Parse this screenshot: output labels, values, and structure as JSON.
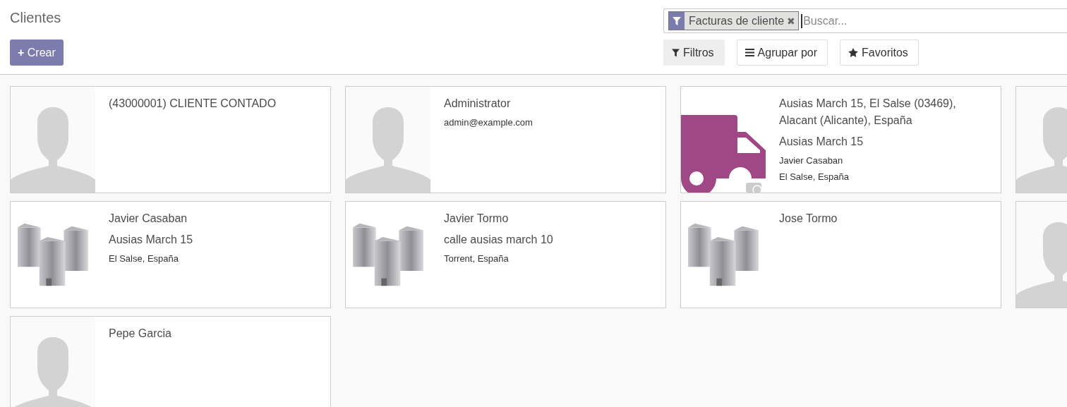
{
  "title": "Clientes",
  "create_button": {
    "icon": "+",
    "label": "Crear"
  },
  "search": {
    "facet": {
      "label": "Facturas de cliente",
      "remove": "✖"
    },
    "placeholder": "Buscar..."
  },
  "buttons": [
    {
      "kind": "filter",
      "label": "Filtros",
      "selected": true
    },
    {
      "kind": "group",
      "label": "Agrupar por",
      "selected": false
    },
    {
      "kind": "star",
      "label": "Favoritos",
      "selected": false
    }
  ],
  "cards": [
    {
      "kind": "person",
      "lines": [
        {
          "kind": "heading",
          "text": "(43000001) CLIENTE CONTADO"
        }
      ]
    },
    {
      "kind": "person",
      "lines": [
        {
          "kind": "heading",
          "text": "Administrator"
        },
        {
          "kind": "detail",
          "text": "admin@example.com"
        }
      ]
    },
    {
      "kind": "truck",
      "lines": [
        {
          "kind": "heading",
          "text": "Ausias March 15, El Salse (03469), Alacant (Alicante), España"
        },
        {
          "kind": "heading",
          "text": "Ausias March 15"
        },
        {
          "kind": "detail",
          "text": "Javier Casaban"
        },
        {
          "kind": "detail",
          "text": "El Salse, España"
        }
      ]
    },
    {
      "kind": "person"
    },
    {
      "kind": "company",
      "lines": [
        {
          "kind": "heading",
          "text": "Javier Casaban"
        },
        {
          "kind": "heading",
          "text": "Ausias March 15"
        },
        {
          "kind": "detail",
          "text": "El Salse, España"
        }
      ]
    },
    {
      "kind": "company",
      "lines": [
        {
          "kind": "heading",
          "text": "Javier Tormo"
        },
        {
          "kind": "heading",
          "text": "calle ausias march 10"
        },
        {
          "kind": "detail",
          "text": "Torrent, España"
        }
      ]
    },
    {
      "kind": "company",
      "lines": [
        {
          "kind": "heading",
          "text": "Jose Tormo"
        }
      ]
    },
    {
      "kind": "person"
    },
    {
      "kind": "person",
      "lines": [
        {
          "kind": "heading",
          "text": "Pepe Garcia"
        }
      ]
    }
  ]
}
